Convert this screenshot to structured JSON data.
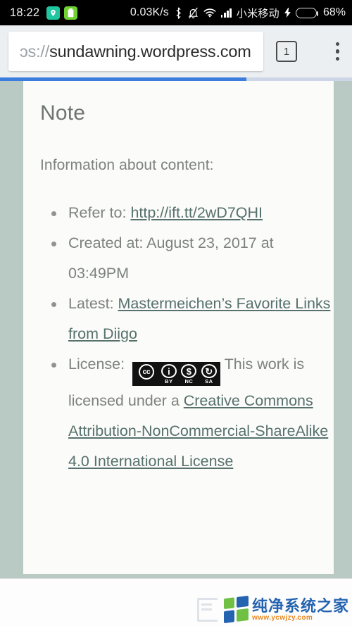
{
  "status_bar": {
    "clock": "18:22",
    "left_icons": [
      {
        "name": "location-badge-icon",
        "glyph": "◉"
      },
      {
        "name": "battery-saver-badge-icon",
        "glyph": "▮"
      }
    ],
    "network_speed": "0.03K/s",
    "icons": [
      {
        "name": "bluetooth-icon"
      },
      {
        "name": "bell-muted-icon"
      },
      {
        "name": "wifi-icon"
      },
      {
        "name": "signal-bars-icon"
      }
    ],
    "carrier": "小米移动",
    "charging": true,
    "battery_percent": "68%",
    "battery_level": 68
  },
  "toolbar": {
    "url_prefix": "ɔs://",
    "url_text": "sundawning.wordpress.com",
    "tab_count": "1",
    "menu_label": "⋮"
  },
  "progress": {
    "percent": 70
  },
  "page": {
    "title": "Note",
    "intro": "Information about content:",
    "items": [
      {
        "label": "Refer to: ",
        "link": "http://ift.tt/2wD7QHI"
      },
      {
        "label": "Created at: August 23, 2017 at 03:49PM"
      },
      {
        "label": "Latest: ",
        "link": "Mastermeichen’s Favorite Links from Diigo"
      },
      {
        "label": "License: ",
        "badge": "cc-by-nc-sa-badge",
        "body_text": "This work is licensed under a ",
        "body_link": "Creative Commons Attribution-NonCommercial-ShareAlike 4.0 International License"
      }
    ],
    "cc_badge": {
      "main": "cc",
      "cells": [
        {
          "sym": "i",
          "label": "BY"
        },
        {
          "sym": "$",
          "label": "NC"
        },
        {
          "sym": "↻",
          "label": "SA"
        }
      ]
    }
  },
  "watermark": {
    "name": "纯净系统之家",
    "url": "www.ycwjzy.com"
  },
  "colors": {
    "accent_blue": "#3b7ddd",
    "link": "#56716c",
    "text": "#7d827e",
    "page_bg": "#b9c9c4",
    "card_bg": "#fbfbfa",
    "battery_green": "#5fd61c"
  }
}
